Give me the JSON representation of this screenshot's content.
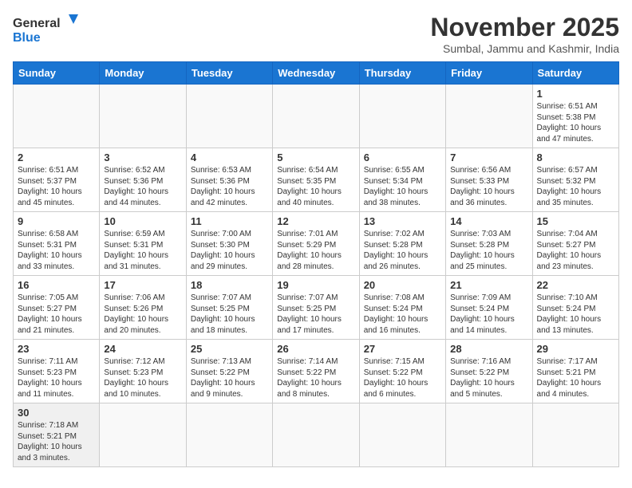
{
  "logo": {
    "text_general": "General",
    "text_blue": "Blue"
  },
  "title": "November 2025",
  "subtitle": "Sumbal, Jammu and Kashmir, India",
  "days_of_week": [
    "Sunday",
    "Monday",
    "Tuesday",
    "Wednesday",
    "Thursday",
    "Friday",
    "Saturday"
  ],
  "weeks": [
    [
      {
        "day": "",
        "info": ""
      },
      {
        "day": "",
        "info": ""
      },
      {
        "day": "",
        "info": ""
      },
      {
        "day": "",
        "info": ""
      },
      {
        "day": "",
        "info": ""
      },
      {
        "day": "",
        "info": ""
      },
      {
        "day": "1",
        "info": "Sunrise: 6:51 AM\nSunset: 5:38 PM\nDaylight: 10 hours\nand 47 minutes."
      }
    ],
    [
      {
        "day": "2",
        "info": "Sunrise: 6:51 AM\nSunset: 5:37 PM\nDaylight: 10 hours\nand 45 minutes."
      },
      {
        "day": "3",
        "info": "Sunrise: 6:52 AM\nSunset: 5:36 PM\nDaylight: 10 hours\nand 44 minutes."
      },
      {
        "day": "4",
        "info": "Sunrise: 6:53 AM\nSunset: 5:36 PM\nDaylight: 10 hours\nand 42 minutes."
      },
      {
        "day": "5",
        "info": "Sunrise: 6:54 AM\nSunset: 5:35 PM\nDaylight: 10 hours\nand 40 minutes."
      },
      {
        "day": "6",
        "info": "Sunrise: 6:55 AM\nSunset: 5:34 PM\nDaylight: 10 hours\nand 38 minutes."
      },
      {
        "day": "7",
        "info": "Sunrise: 6:56 AM\nSunset: 5:33 PM\nDaylight: 10 hours\nand 36 minutes."
      },
      {
        "day": "8",
        "info": "Sunrise: 6:57 AM\nSunset: 5:32 PM\nDaylight: 10 hours\nand 35 minutes."
      }
    ],
    [
      {
        "day": "9",
        "info": "Sunrise: 6:58 AM\nSunset: 5:31 PM\nDaylight: 10 hours\nand 33 minutes."
      },
      {
        "day": "10",
        "info": "Sunrise: 6:59 AM\nSunset: 5:31 PM\nDaylight: 10 hours\nand 31 minutes."
      },
      {
        "day": "11",
        "info": "Sunrise: 7:00 AM\nSunset: 5:30 PM\nDaylight: 10 hours\nand 29 minutes."
      },
      {
        "day": "12",
        "info": "Sunrise: 7:01 AM\nSunset: 5:29 PM\nDaylight: 10 hours\nand 28 minutes."
      },
      {
        "day": "13",
        "info": "Sunrise: 7:02 AM\nSunset: 5:28 PM\nDaylight: 10 hours\nand 26 minutes."
      },
      {
        "day": "14",
        "info": "Sunrise: 7:03 AM\nSunset: 5:28 PM\nDaylight: 10 hours\nand 25 minutes."
      },
      {
        "day": "15",
        "info": "Sunrise: 7:04 AM\nSunset: 5:27 PM\nDaylight: 10 hours\nand 23 minutes."
      }
    ],
    [
      {
        "day": "16",
        "info": "Sunrise: 7:05 AM\nSunset: 5:27 PM\nDaylight: 10 hours\nand 21 minutes."
      },
      {
        "day": "17",
        "info": "Sunrise: 7:06 AM\nSunset: 5:26 PM\nDaylight: 10 hours\nand 20 minutes."
      },
      {
        "day": "18",
        "info": "Sunrise: 7:07 AM\nSunset: 5:25 PM\nDaylight: 10 hours\nand 18 minutes."
      },
      {
        "day": "19",
        "info": "Sunrise: 7:07 AM\nSunset: 5:25 PM\nDaylight: 10 hours\nand 17 minutes."
      },
      {
        "day": "20",
        "info": "Sunrise: 7:08 AM\nSunset: 5:24 PM\nDaylight: 10 hours\nand 16 minutes."
      },
      {
        "day": "21",
        "info": "Sunrise: 7:09 AM\nSunset: 5:24 PM\nDaylight: 10 hours\nand 14 minutes."
      },
      {
        "day": "22",
        "info": "Sunrise: 7:10 AM\nSunset: 5:24 PM\nDaylight: 10 hours\nand 13 minutes."
      }
    ],
    [
      {
        "day": "23",
        "info": "Sunrise: 7:11 AM\nSunset: 5:23 PM\nDaylight: 10 hours\nand 11 minutes."
      },
      {
        "day": "24",
        "info": "Sunrise: 7:12 AM\nSunset: 5:23 PM\nDaylight: 10 hours\nand 10 minutes."
      },
      {
        "day": "25",
        "info": "Sunrise: 7:13 AM\nSunset: 5:22 PM\nDaylight: 10 hours\nand 9 minutes."
      },
      {
        "day": "26",
        "info": "Sunrise: 7:14 AM\nSunset: 5:22 PM\nDaylight: 10 hours\nand 8 minutes."
      },
      {
        "day": "27",
        "info": "Sunrise: 7:15 AM\nSunset: 5:22 PM\nDaylight: 10 hours\nand 6 minutes."
      },
      {
        "day": "28",
        "info": "Sunrise: 7:16 AM\nSunset: 5:22 PM\nDaylight: 10 hours\nand 5 minutes."
      },
      {
        "day": "29",
        "info": "Sunrise: 7:17 AM\nSunset: 5:21 PM\nDaylight: 10 hours\nand 4 minutes."
      }
    ],
    [
      {
        "day": "30",
        "info": "Sunrise: 7:18 AM\nSunset: 5:21 PM\nDaylight: 10 hours\nand 3 minutes."
      },
      {
        "day": "",
        "info": ""
      },
      {
        "day": "",
        "info": ""
      },
      {
        "day": "",
        "info": ""
      },
      {
        "day": "",
        "info": ""
      },
      {
        "day": "",
        "info": ""
      },
      {
        "day": "",
        "info": ""
      }
    ]
  ]
}
